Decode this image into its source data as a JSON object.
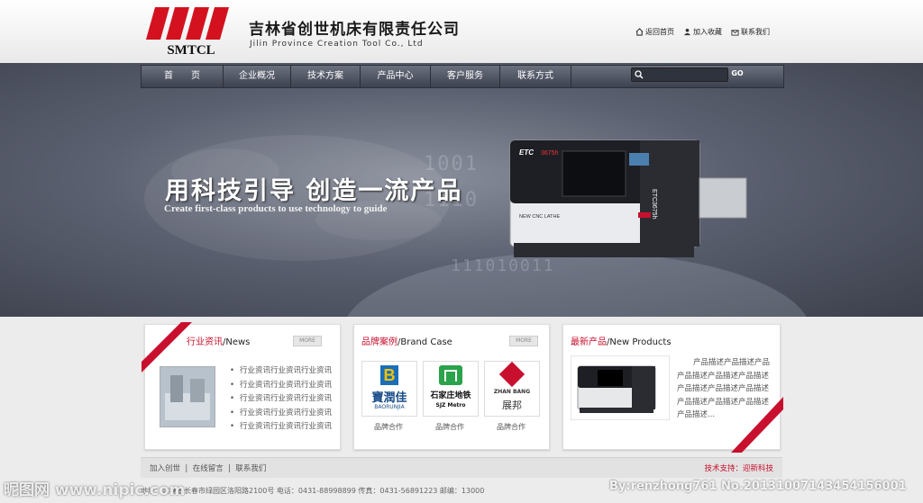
{
  "header": {
    "logo_text": "SMTCL",
    "company_cn": "吉林省创世机床有限责任公司",
    "company_en": "Jilin Province Creation Tool Co., Ltd",
    "links": [
      {
        "label": "返回首页",
        "icon": "home-icon"
      },
      {
        "label": "加入收藏",
        "icon": "users-icon"
      },
      {
        "label": "联系我们",
        "icon": "contact-icon"
      }
    ]
  },
  "nav": {
    "items": [
      "首　　页",
      "企业概况",
      "技术方案",
      "产品中心",
      "客户服务",
      "联系方式"
    ],
    "search_placeholder": "",
    "search_button": "GO"
  },
  "banner": {
    "slogan_cn": "用科技引导 创造一流产品",
    "slogan_en": "Create first-class products to use technology to guide",
    "machine_label": "NEW CNC LATHE",
    "machine_model": "ETC3675h"
  },
  "news": {
    "title_cn": "行业资讯",
    "title_en": "/News",
    "more": "MORE",
    "items": [
      "行业资讯行业资讯行业资讯",
      "行业资讯行业资讯行业资讯",
      "行业资讯行业资讯行业资讯",
      "行业资讯行业资讯行业资讯",
      "行业资讯行业资讯行业资讯"
    ]
  },
  "brand": {
    "title_cn": "品牌案例",
    "title_en": "/Brand Case",
    "more": "MORE",
    "items": [
      {
        "name_cn": "寶潤佳",
        "name_en": "BAORUNJIA",
        "caption": "品牌合作"
      },
      {
        "name_cn": "石家庄地铁",
        "name_en": "SJZ Metro",
        "caption": "品牌合作"
      },
      {
        "name_cn": "展邦",
        "name_en": "ZHAN BANG",
        "caption": "品牌合作"
      }
    ]
  },
  "products": {
    "title_cn": "最新产品",
    "title_en": "/New Products",
    "description": "产品描述产品描述产品产品描述产品描述产品描述产品描述产品描述产品描述产品描述产品描述产品描述产品描述..."
  },
  "footer": {
    "links": [
      "加入创世",
      "在线留言",
      "联系我们"
    ],
    "separator": "|",
    "tech_support": "技术支持：迎新科技",
    "address": "地址：吉林省长春市绿园区洛阳路2100号 电话：0431-88998899 传真：0431-56891223 邮编：13000"
  },
  "watermark": {
    "left": "昵图网 www.nipic.com",
    "right": "By:renzhong761 No.20131007143454156001"
  },
  "colors": {
    "accent": "#c8102e",
    "nav": "#4a4f5c"
  }
}
